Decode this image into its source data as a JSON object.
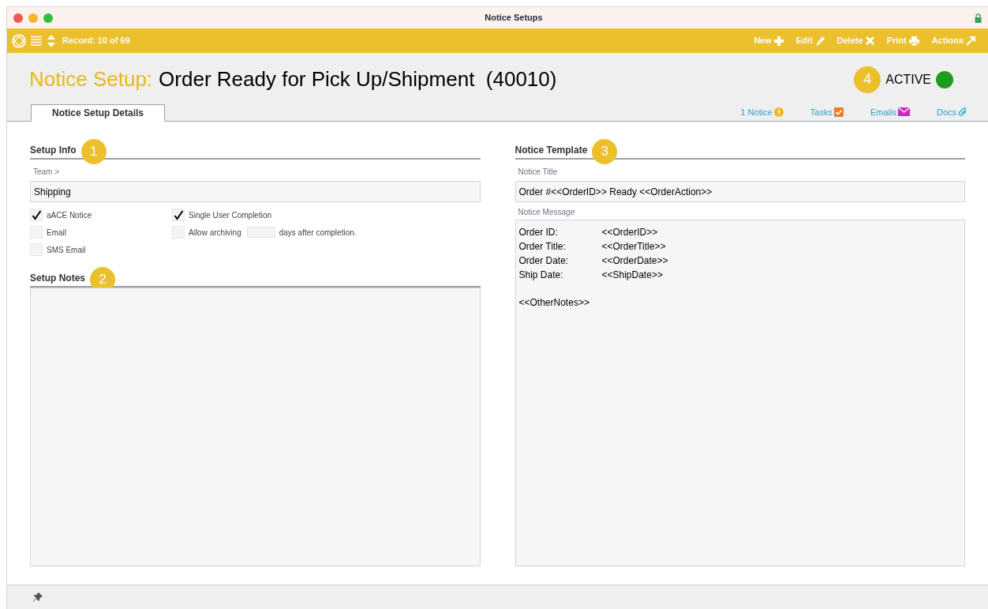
{
  "window": {
    "title": "Notice Setups"
  },
  "toolbar": {
    "record": "Record: 10 of 69",
    "actions": [
      {
        "label": "New",
        "kind": "plus"
      },
      {
        "label": "Edit",
        "kind": "pencil"
      },
      {
        "label": "Delete",
        "kind": "x"
      },
      {
        "label": "Print",
        "kind": "printer"
      },
      {
        "label": "Actions",
        "kind": "arrow"
      }
    ]
  },
  "header": {
    "prefix": "Notice Setup:",
    "title": "Order Ready for Pick Up/Shipment  (40010)",
    "badge": "4",
    "status": "ACTIVE",
    "active": true
  },
  "tabs": [
    {
      "label": "Notice Setup Details",
      "selected": true
    }
  ],
  "links": [
    {
      "label": "1 Notice",
      "kind": "alert"
    },
    {
      "label": "Tasks",
      "kind": "task"
    },
    {
      "label": "Emails",
      "kind": "mail"
    },
    {
      "label": "Docs",
      "kind": "clip"
    }
  ],
  "setup_info": {
    "heading": "Setup Info",
    "badge": "1",
    "team_label": "Team >",
    "team": "Shipping",
    "option_columns": [
      [
        {
          "kind": "checkbox",
          "label": "aACE Notice",
          "checked": true
        },
        {
          "kind": "checkbox",
          "label": "Email",
          "checked": false
        },
        {
          "kind": "checkbox",
          "label": "SMS Email",
          "checked": false
        }
      ],
      [
        {
          "kind": "checkbox",
          "label": "Single User Completion",
          "checked": true
        },
        {
          "kind": "archive",
          "label": "Allow archiving",
          "suffix": "days after completion.",
          "checked": false
        }
      ]
    ]
  },
  "setup_notes": {
    "heading": "Setup Notes",
    "badge": "2"
  },
  "notice_template": {
    "heading": "Notice Template",
    "badge": "3",
    "title_label": "Notice Title",
    "title": "Order #<<OrderID>> Ready <<OrderAction>>",
    "message_label": "Notice Message",
    "message_rows": [
      {
        "label": "Order ID:",
        "value": "<<OrderID>>"
      },
      {
        "label": "Order Title:",
        "value": "<<OrderTitle>>"
      },
      {
        "label": "Order Date:",
        "value": "<<OrderDate>>"
      },
      {
        "label": "Ship Date:",
        "value": "<<ShipDate>>"
      }
    ],
    "message_footer": "<<OtherNotes>>"
  }
}
